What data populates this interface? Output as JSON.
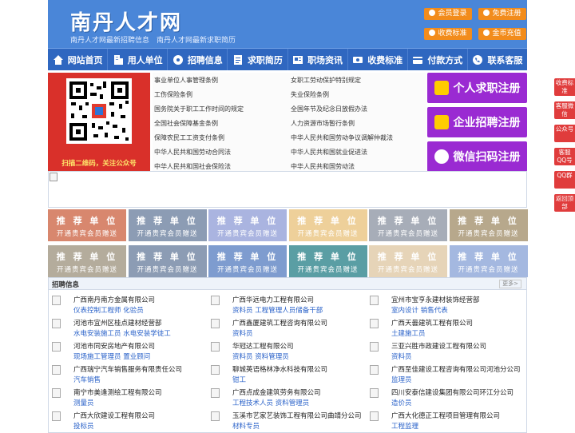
{
  "header": {
    "logo": "南丹人才网",
    "slogan": "南丹人才网最新招聘信息　南丹人才网最新求职简历",
    "buttons": [
      {
        "label": "会员登录"
      },
      {
        "label": "免费注册"
      },
      {
        "label": "收费标准"
      },
      {
        "label": "金币充值"
      }
    ]
  },
  "nav": [
    {
      "label": "网站首页",
      "icon": "home-icon"
    },
    {
      "label": "用人单位",
      "icon": "building-icon"
    },
    {
      "label": "招聘信息",
      "icon": "broadcast-icon"
    },
    {
      "label": "求职简历",
      "icon": "resume-icon"
    },
    {
      "label": "职场资讯",
      "icon": "news-icon"
    },
    {
      "label": "收费标准",
      "icon": "coin-icon"
    },
    {
      "label": "付款方式",
      "icon": "card-icon"
    },
    {
      "label": "联系客服",
      "icon": "phone-icon"
    }
  ],
  "qr": {
    "caption": "扫描二维码，关注公众号"
  },
  "links": [
    [
      "事业单位人事管理条例",
      "女职工劳动保护特别规定"
    ],
    [
      "工伤保险条例",
      "失业保险条例"
    ],
    [
      "国务院关于职工工作时间的规定",
      "全国年节及纪念日放假办法"
    ],
    [
      "全国社会保障基金条例",
      "人力资源市场暂行条例"
    ],
    [
      "保障农民工工资支付条例",
      "中华人民共和国劳动争议调解仲裁法"
    ],
    [
      "中华人民共和国劳动合同法",
      "中华人民共和国就业促进法"
    ],
    [
      "中华人民共和国社会保险法",
      "中华人民共和国劳动法"
    ]
  ],
  "register": [
    {
      "label": "个人求职注册"
    },
    {
      "label": "企业招聘注册"
    },
    {
      "label": "微信扫码注册"
    }
  ],
  "tiles": {
    "title": "推 荐 单 位",
    "sub": "开通贵宾会员赠送",
    "colors": [
      "#d8876e",
      "#8c9cb4",
      "#aab4e0",
      "#eed09a",
      "#a7adb8",
      "#b7a88c",
      "#b4ac9c",
      "#8c9cb4",
      "#7e9ccf",
      "#5a9ea4",
      "#e6d4b8",
      "#a4b8e0"
    ]
  },
  "jobs": {
    "title": "招聘信息",
    "more": "更多>",
    "items": [
      {
        "company": "广西南丹南方金属有限公司",
        "positions": "仪表控制工程师 化验员"
      },
      {
        "company": "广西华远电力工程有限公司",
        "positions": "资料员 工程管理人员储备干部"
      },
      {
        "company": "宜州市宝亨永建材装饰经营部",
        "positions": "室内设计 销售代表"
      },
      {
        "company": "河池市宜州区桂点建材经营部",
        "positions": "水电安装施工员 水电安装学徒工"
      },
      {
        "company": "广西鑫厦建筑工程咨询有限公司",
        "positions": "资料员"
      },
      {
        "company": "广西天曇建筑工程有限公司",
        "positions": "土建施工员"
      },
      {
        "company": "河池市同安房地产有限公司",
        "positions": "现场施工管理员 置业顾问"
      },
      {
        "company": "华冠达工程有限公司",
        "positions": "资料员 资料管理员"
      },
      {
        "company": "三亚兴胜市政建设工程有限公司",
        "positions": "资料员"
      },
      {
        "company": "广西瑞宁汽车销售服务有限责任公司",
        "positions": "汽车销售"
      },
      {
        "company": "聊城英语格林净水科技有限公司",
        "positions": "钳工"
      },
      {
        "company": "广西至佳建设工程咨询有限公司河池分公司",
        "positions": "监理员"
      },
      {
        "company": "南宁市美逢测绘工程有限公司",
        "positions": "测量员"
      },
      {
        "company": "广西点成金建筑劳务有限公司",
        "positions": "工程技术人员 资料管理员"
      },
      {
        "company": "四川安泰信建设集团有限公司环江分公司",
        "positions": "造价员"
      },
      {
        "company": "广西大欣建设工程有限公司",
        "positions": "投标员"
      },
      {
        "company": "玉溪市艺家艺装饰工程有限公司曲靖分公司",
        "positions": "材料专员"
      },
      {
        "company": "广西大化德正工程项目管理有限公司",
        "positions": "工程监理"
      }
    ]
  },
  "float": [
    {
      "label": "收费标准"
    },
    {
      "label": "客服微信"
    },
    {
      "label": "公众号"
    },
    {
      "label": "客服QQ号"
    },
    {
      "label": "QQ群"
    },
    {
      "label": "返回顶部"
    }
  ]
}
